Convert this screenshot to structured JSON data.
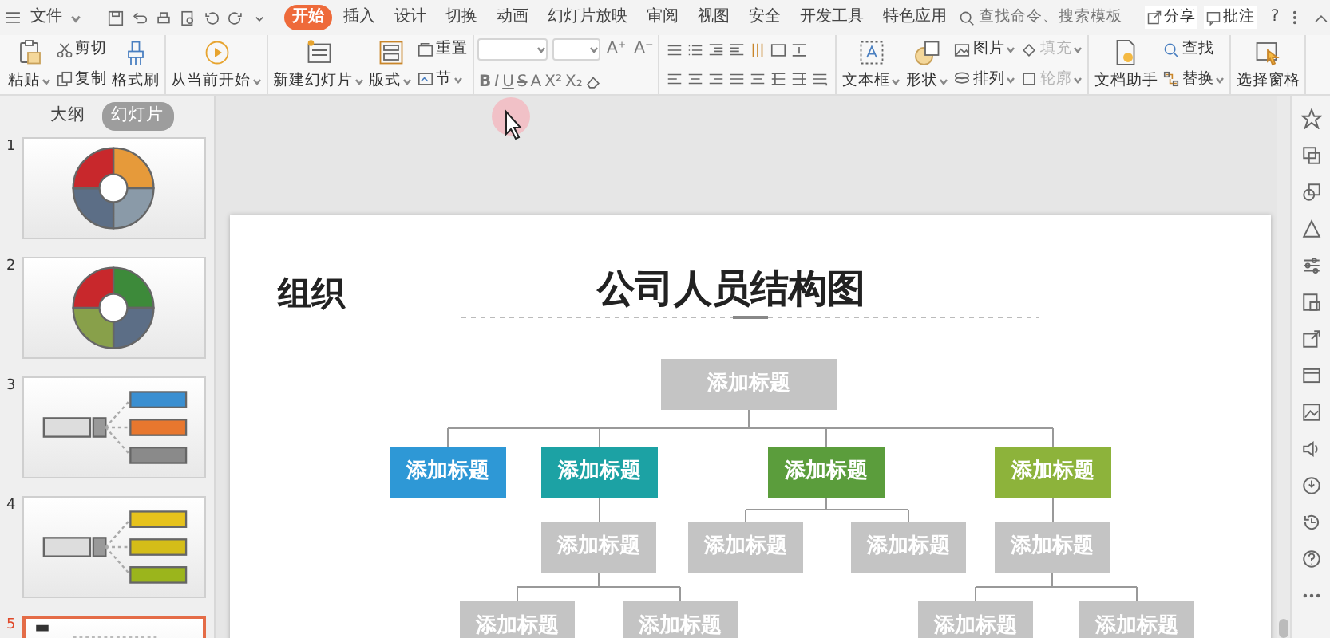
{
  "menu_bar": {
    "file_label": "文件",
    "tabs": [
      {
        "label": "开始",
        "selected": true
      },
      {
        "label": "插入",
        "selected": false
      },
      {
        "label": "设计",
        "selected": false
      },
      {
        "label": "切换",
        "selected": false
      },
      {
        "label": "动画",
        "selected": false
      },
      {
        "label": "幻灯片放映",
        "selected": false
      },
      {
        "label": "审阅",
        "selected": false
      },
      {
        "label": "视图",
        "selected": false
      },
      {
        "label": "安全",
        "selected": false
      },
      {
        "label": "开发工具",
        "selected": false
      },
      {
        "label": "特色应用",
        "selected": false
      }
    ],
    "search": {
      "placeholder": "查找命令、搜索模板"
    },
    "share_label": "分享",
    "comment_label": "批注",
    "help_label": "?"
  },
  "ribbon": {
    "groups": [
      {
        "items": [
          {
            "kind": "large",
            "label": "粘贴",
            "dropdown": true,
            "disabled": false
          },
          {
            "kind": "small",
            "label": "剪切",
            "dropdown": false,
            "disabled": false
          },
          {
            "kind": "small",
            "label": "复制",
            "dropdown": false,
            "disabled": false
          },
          {
            "kind": "large",
            "label": "格式刷",
            "dropdown": false,
            "disabled": false
          }
        ]
      },
      {
        "items": [
          {
            "kind": "large",
            "label": "从当前开始",
            "dropdown": true,
            "disabled": false
          }
        ]
      },
      {
        "items": [
          {
            "kind": "large",
            "label": "新建幻灯片",
            "dropdown": true,
            "disabled": false
          },
          {
            "kind": "large",
            "label": "版式",
            "dropdown": true,
            "disabled": false
          },
          {
            "kind": "small",
            "label": "重置",
            "dropdown": false,
            "disabled": false
          },
          {
            "kind": "small",
            "label": "节",
            "dropdown": true,
            "disabled": false
          }
        ]
      },
      {
        "items": [
          {
            "kind": "font"
          }
        ]
      },
      {
        "items": [
          {
            "kind": "paragraph"
          }
        ]
      },
      {
        "items": [
          {
            "kind": "large",
            "label": "文本框",
            "dropdown": true,
            "disabled": false
          },
          {
            "kind": "large",
            "label": "形状",
            "dropdown": true,
            "disabled": false
          },
          {
            "kind": "small",
            "label": "图片",
            "dropdown": true,
            "disabled": false
          },
          {
            "kind": "small",
            "label": "排列",
            "dropdown": true,
            "disabled": false
          },
          {
            "kind": "small",
            "label": "填充",
            "dropdown": true,
            "disabled": true
          },
          {
            "kind": "small",
            "label": "轮廓",
            "dropdown": true,
            "disabled": true
          }
        ]
      },
      {
        "items": [
          {
            "kind": "large",
            "label": "文档助手",
            "dropdown": false,
            "disabled": false
          },
          {
            "kind": "small",
            "label": "查找",
            "dropdown": false,
            "disabled": false
          },
          {
            "kind": "small",
            "label": "替换",
            "dropdown": true,
            "disabled": false
          }
        ]
      },
      {
        "items": [
          {
            "kind": "large",
            "label": "选择窗格",
            "dropdown": false,
            "disabled": false
          }
        ]
      }
    ],
    "font_buttons": [
      "A⁺",
      "A⁻"
    ],
    "format_buttons": [
      "B",
      "I",
      "U",
      "S",
      "A",
      "X²",
      "X₂"
    ]
  },
  "sidebar": {
    "tabs": [
      {
        "label": "大纲",
        "selected": false
      },
      {
        "label": "幻灯片",
        "selected": true
      }
    ],
    "slides": [
      {
        "number": "1",
        "kind": "wheel",
        "selected": false
      },
      {
        "number": "2",
        "kind": "wheel",
        "selected": false
      },
      {
        "number": "3",
        "kind": "branch",
        "selected": false
      },
      {
        "number": "4",
        "kind": "branch",
        "selected": false
      },
      {
        "number": "5",
        "kind": "org",
        "selected": true
      }
    ]
  },
  "slide": {
    "heading": "组织",
    "title": "公司人员结构图",
    "org_chart": {
      "label": "添加标题",
      "color": "#c4c4c4",
      "children": [
        {
          "label": "添加标题",
          "color": "#2e98d6"
        },
        {
          "label": "添加标题",
          "color": "#1ca2a4",
          "children": [
            {
              "label": "添加标题",
              "color": "#c4c4c4",
              "children": [
                {
                  "label": "添加标题",
                  "color": "#c4c4c4"
                },
                {
                  "label": "添加标题",
                  "color": "#c4c4c4"
                }
              ]
            }
          ]
        },
        {
          "label": "添加标题",
          "color": "#5b9d3c",
          "children": [
            {
              "label": "添加标题",
              "color": "#c4c4c4"
            },
            {
              "label": "添加标题",
              "color": "#c4c4c4"
            }
          ]
        },
        {
          "label": "添加标题",
          "color": "#8db33b",
          "children": [
            {
              "label": "添加标题",
              "color": "#c4c4c4",
              "children": [
                {
                  "label": "添加标题",
                  "color": "#c4c4c4"
                },
                {
                  "label": "添加标题",
                  "color": "#c4c4c4"
                }
              ]
            }
          ]
        }
      ]
    }
  }
}
